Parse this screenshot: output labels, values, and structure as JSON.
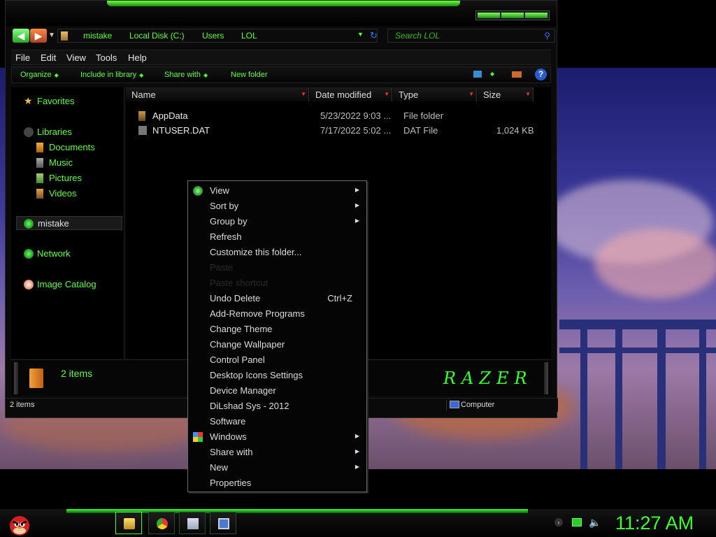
{
  "address": {
    "crumbs": [
      "mistake",
      "Local Disk (C:)",
      "Users",
      "LOL"
    ],
    "search_placeholder": "Search LOL"
  },
  "menubar": [
    "File",
    "Edit",
    "View",
    "Tools",
    "Help"
  ],
  "toolbar": {
    "organize": "Organize",
    "include": "Include in library",
    "share": "Share with",
    "newfolder": "New folder"
  },
  "navpane": {
    "favorites": "Favorites",
    "libraries": "Libraries",
    "documents": "Documents",
    "music": "Music",
    "pictures": "Pictures",
    "videos": "Videos",
    "mistake": "mistake",
    "network": "Network",
    "image_catalog": "Image Catalog"
  },
  "columns": {
    "name": "Name",
    "date": "Date modified",
    "type": "Type",
    "size": "Size"
  },
  "files": [
    {
      "name": "AppData",
      "date": "5/23/2022 9:03 ...",
      "type": "File folder",
      "size": ""
    },
    {
      "name": "NTUSER.DAT",
      "date": "7/17/2022 5:02 ...",
      "type": "DAT File",
      "size": "1,024 KB"
    }
  ],
  "details": {
    "count": "2 items",
    "logo": "RAZER"
  },
  "status": {
    "count": "2 items",
    "computer": "Computer"
  },
  "context_menu": [
    {
      "label": "View",
      "sub": true
    },
    {
      "label": "Sort by",
      "sub": true
    },
    {
      "label": "Group by",
      "sub": true
    },
    {
      "label": "Refresh"
    },
    {
      "label": "Customize this folder..."
    },
    {
      "label": "Paste",
      "disabled": true
    },
    {
      "label": "Paste shortcut",
      "disabled": true
    },
    {
      "label": "Undo Delete",
      "shortcut": "Ctrl+Z"
    },
    {
      "label": "Add-Remove Programs"
    },
    {
      "label": "Change Theme"
    },
    {
      "label": "Change Wallpaper"
    },
    {
      "label": "Control Panel"
    },
    {
      "label": "Desktop Icons Settings"
    },
    {
      "label": "Device Manager"
    },
    {
      "label": "DiLshad Sys - 2012"
    },
    {
      "label": "Software"
    },
    {
      "label": "Windows",
      "sub": true
    },
    {
      "label": "Share with",
      "sub": true
    },
    {
      "label": "New",
      "sub": true
    },
    {
      "label": "Properties"
    }
  ],
  "taskbar": {
    "clock": "11:27 AM"
  },
  "colors": {
    "accent_green": "#3aff2a",
    "text_green": "#5bff3a"
  }
}
